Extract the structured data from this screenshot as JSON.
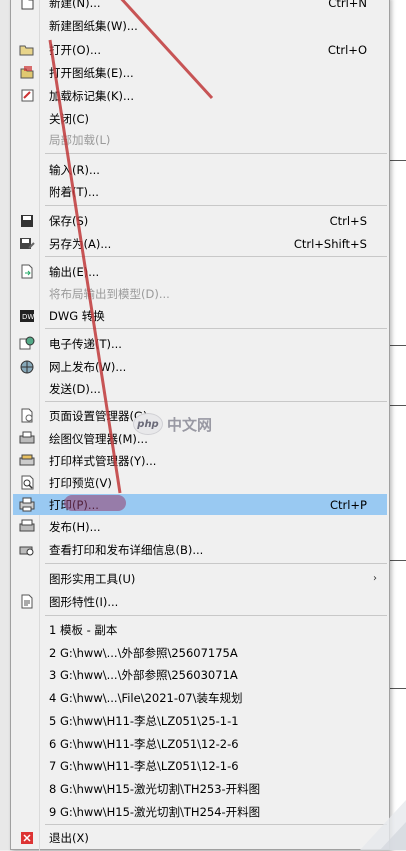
{
  "colors": {
    "highlight": "#99c9f2",
    "annotation": "#c0393b",
    "disabled": "#9a9a9a"
  },
  "menu": {
    "items": [
      {
        "label": "新建(N)...",
        "shortcut": "Ctrl+N",
        "icon": "new-file-icon"
      },
      {
        "label": "新建图纸集(W)...",
        "shortcut": "",
        "icon": ""
      },
      {
        "label": "打开(O)...",
        "shortcut": "Ctrl+O",
        "icon": "open-folder-icon"
      },
      {
        "label": "打开图纸集(E)...",
        "shortcut": "",
        "icon": "open-sheetset-icon"
      },
      {
        "label": "加载标记集(K)...",
        "shortcut": "",
        "icon": "markup-icon"
      },
      {
        "label": "关闭(C)",
        "shortcut": "",
        "icon": ""
      },
      {
        "label": "局部加载(L)",
        "shortcut": "",
        "icon": "",
        "disabled": true
      },
      {
        "label": "输入(R)...",
        "shortcut": "",
        "icon": ""
      },
      {
        "label": "附着(T)...",
        "shortcut": "",
        "icon": ""
      },
      {
        "label": "保存(S)",
        "shortcut": "Ctrl+S",
        "icon": "save-icon"
      },
      {
        "label": "另存为(A)...",
        "shortcut": "Ctrl+Shift+S",
        "icon": "save-as-icon"
      },
      {
        "label": "输出(E)...",
        "shortcut": "",
        "icon": "export-icon"
      },
      {
        "label": "将布局输出到模型(D)...",
        "shortcut": "",
        "icon": "",
        "disabled": true
      },
      {
        "label": "DWG 转换",
        "shortcut": "",
        "icon": "dwg-convert-icon"
      },
      {
        "label": "电子传递(T)...",
        "shortcut": "",
        "icon": "etransmit-icon"
      },
      {
        "label": "网上发布(W)...",
        "shortcut": "",
        "icon": "web-publish-icon"
      },
      {
        "label": "发送(D)...",
        "shortcut": "",
        "icon": ""
      },
      {
        "label": "页面设置管理器(G)...",
        "shortcut": "",
        "icon": "page-setup-icon"
      },
      {
        "label": "绘图仪管理器(M)...",
        "shortcut": "",
        "icon": "plotter-icon"
      },
      {
        "label": "打印样式管理器(Y)...",
        "shortcut": "",
        "icon": "plot-style-icon"
      },
      {
        "label": "打印预览(V)",
        "shortcut": "",
        "icon": "print-preview-icon"
      },
      {
        "label": "打印(P)...",
        "shortcut": "Ctrl+P",
        "icon": "printer-icon",
        "highlighted": true
      },
      {
        "label": "发布(H)...",
        "shortcut": "",
        "icon": "publish-icon"
      },
      {
        "label": "查看打印和发布详细信息(B)...",
        "shortcut": "",
        "icon": "plot-details-icon"
      },
      {
        "label": "图形实用工具(U)",
        "shortcut": "",
        "icon": "",
        "submenu": true
      },
      {
        "label": "图形特性(I)...",
        "shortcut": "",
        "icon": "drawing-properties-icon"
      },
      {
        "label": "1 模板 - 副本",
        "shortcut": "",
        "icon": ""
      },
      {
        "label": "2 G:\\hww\\...\\外部参照\\25607175A",
        "shortcut": "",
        "icon": ""
      },
      {
        "label": "3 G:\\hww\\...\\外部参照\\25603071A",
        "shortcut": "",
        "icon": ""
      },
      {
        "label": "4 G:\\hww\\...\\File\\2021-07\\装车规划",
        "shortcut": "",
        "icon": ""
      },
      {
        "label": "5 G:\\hww\\H11-李总\\LZ051\\25-1-1",
        "shortcut": "",
        "icon": ""
      },
      {
        "label": "6 G:\\hww\\H11-李总\\LZ051\\12-2-6",
        "shortcut": "",
        "icon": ""
      },
      {
        "label": "7 G:\\hww\\H11-李总\\LZ051\\12-1-6",
        "shortcut": "",
        "icon": ""
      },
      {
        "label": "8 G:\\hww\\H15-激光切割\\TH253-开料图",
        "shortcut": "",
        "icon": ""
      },
      {
        "label": "9 G:\\hww\\H15-激光切割\\TH254-开料图",
        "shortcut": "",
        "icon": ""
      },
      {
        "label": "退出(X)",
        "shortcut": "",
        "icon": "exit-icon"
      }
    ]
  },
  "watermark": {
    "logo": "php",
    "text": "中文网"
  }
}
